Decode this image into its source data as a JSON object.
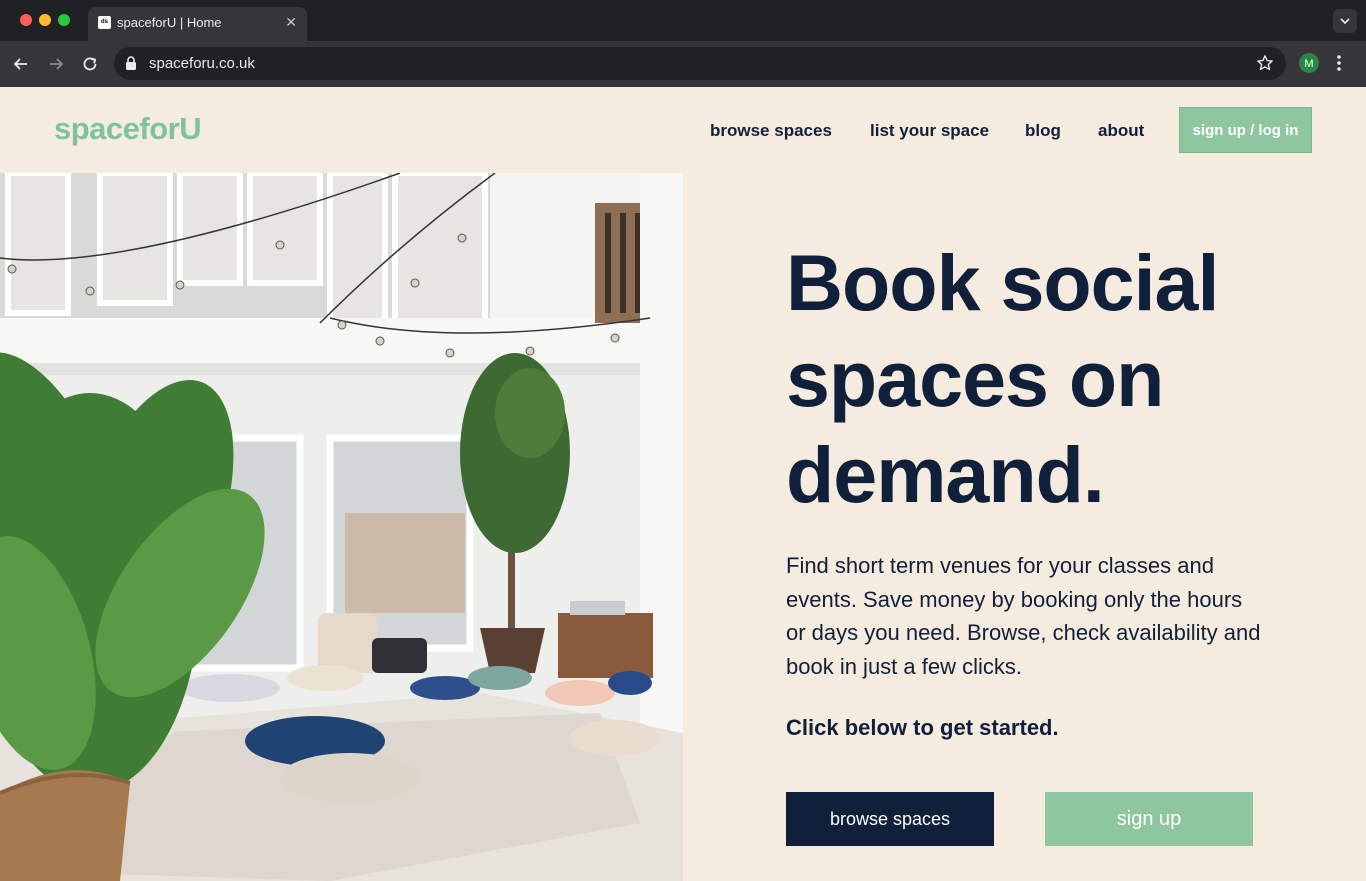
{
  "browser": {
    "tab_title": "spaceforU | Home",
    "favicon_text": "ds",
    "url": "spaceforu.co.uk",
    "profile_initial": "M"
  },
  "header": {
    "logo": "spaceforU",
    "nav": [
      "browse spaces",
      "list your space",
      "blog",
      "about"
    ],
    "cta": "sign up / log in"
  },
  "hero": {
    "image": "interior-room-with-cushions-and-plants",
    "headline_lines": [
      "Book social",
      "spaces on",
      "demand."
    ],
    "description": "Find short term venues for your classes and events. Save money by booking only the hours or days you need. Browse, check availability and book in just a few clicks.",
    "cta_note": "Click below to get started.",
    "primary_button": "browse spaces",
    "secondary_button": "sign up"
  },
  "colors": {
    "background": "#f5ebde",
    "navy": "#10203b",
    "accent_green": "#8ec6a0"
  }
}
